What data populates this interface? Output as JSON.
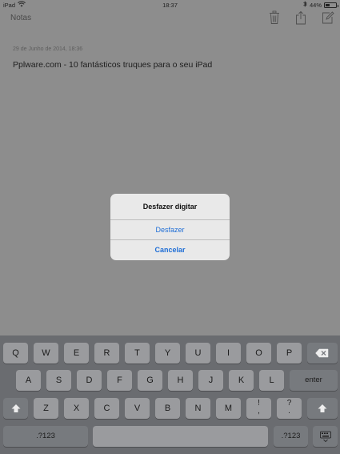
{
  "status_bar": {
    "device": "iPad",
    "time": "18:37",
    "battery_percent": "44%",
    "battery_level": 0.44
  },
  "nav": {
    "back_label": "Notas",
    "icons": [
      "trash-icon",
      "share-icon",
      "compose-icon"
    ]
  },
  "note": {
    "date": "29 de Junho de 2014, 18:36",
    "text": "Pplware.com - 10 fantásticos truques para o seu iPad"
  },
  "alert": {
    "title": "Desfazer digitar",
    "primary_action": "Desfazer",
    "cancel_action": "Cancelar",
    "accent_color": "#1f6ed6"
  },
  "keyboard": {
    "row1": [
      "Q",
      "W",
      "E",
      "R",
      "T",
      "Y",
      "U",
      "I",
      "O",
      "P"
    ],
    "row2": [
      "A",
      "S",
      "D",
      "F",
      "G",
      "H",
      "J",
      "K",
      "L"
    ],
    "row3": [
      "Z",
      "X",
      "C",
      "V",
      "B",
      "N",
      "M"
    ],
    "punct1_top": "!",
    "punct1_bottom": ",",
    "punct2_top": "?",
    "punct2_bottom": ".",
    "enter_label": "enter",
    "numbers_left": ".?123",
    "numbers_right": ".?123",
    "space_label": ""
  }
}
